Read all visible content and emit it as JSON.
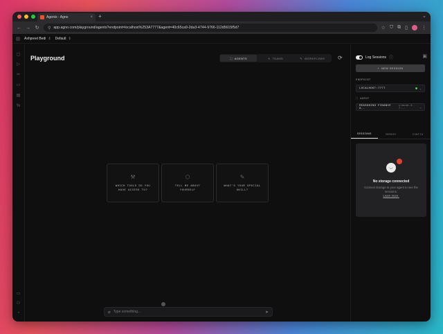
{
  "browser": {
    "tab_title": "Agents - Agno",
    "url": "app.agno.com/playground/agents?endpoint=localhost%253A7777&agent=40c65ca9-2da3-4744-9766-112d5615f5d7",
    "dot_colors": [
      "#fe5f57",
      "#febc2e",
      "#28c840"
    ]
  },
  "header": {
    "workspace": "Ashpreet Bedi",
    "project": "Default"
  },
  "main": {
    "title": "Playground",
    "modes": [
      {
        "label": "AGENTS",
        "icon": "agents-icon",
        "active": true
      },
      {
        "label": "TEAMS",
        "icon": "teams-icon",
        "active": false
      },
      {
        "label": "WORKFLOWS",
        "icon": "workflows-icon",
        "active": false
      }
    ],
    "suggestions": [
      {
        "text": "WHICH TOOLS DO YOU HAVE ACCESS TO?",
        "icon": "wrench-icon"
      },
      {
        "text": "TELL ME ABOUT YOURSELF",
        "icon": "cube-icon"
      },
      {
        "text": "WHAT'S YOUR SPECIAL SKILL?",
        "icon": "pen-icon"
      }
    ],
    "chat_placeholder": "Type something..."
  },
  "panel": {
    "log_sessions_label": "Log Sessions",
    "new_session_label": "NEW SESSION",
    "endpoint_label": "ENDPOINT",
    "endpoint_value": "LOCALHOST:7777",
    "endpoint_status_color": "#3ecf5a",
    "agent_label": "AGENT",
    "agent_value": "REASONING FINANCE A..",
    "agent_model": "claude-3-7...",
    "tabs": [
      "SESSIONS",
      "MEMORY",
      "CONFIG"
    ],
    "storage_title": "No storage connected",
    "storage_desc": "Connect storage to your agent to see the sessions.",
    "storage_link": "Learn more."
  }
}
